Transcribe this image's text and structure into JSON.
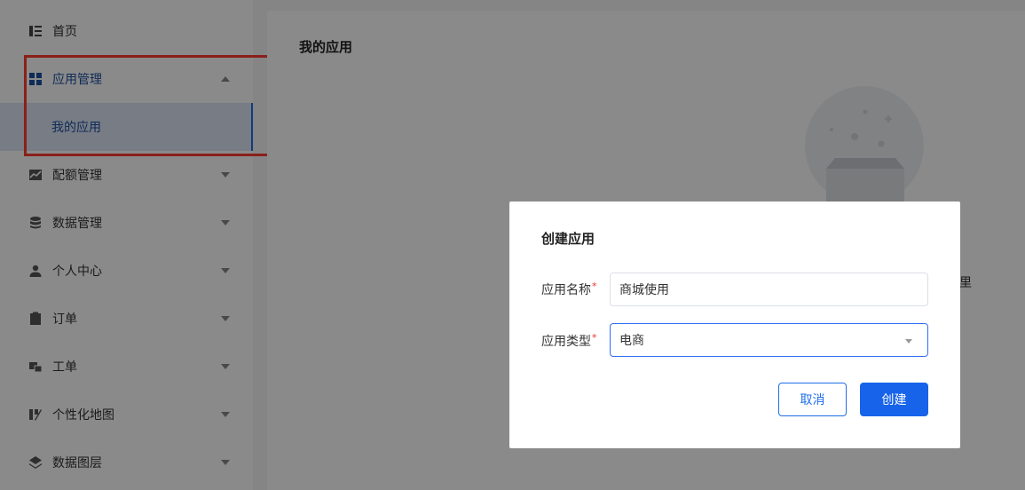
{
  "sidebar": {
    "items": [
      {
        "label": "首页",
        "icon": "home-list-icon"
      },
      {
        "label": "应用管理",
        "icon": "apps-grid-icon",
        "expanded": true
      },
      {
        "label": "配额管理",
        "icon": "quota-chart-icon"
      },
      {
        "label": "数据管理",
        "icon": "database-icon"
      },
      {
        "label": "个人中心",
        "icon": "user-icon"
      },
      {
        "label": "订单",
        "icon": "clipboard-icon"
      },
      {
        "label": "工单",
        "icon": "ticket-icon"
      },
      {
        "label": "个性化地图",
        "icon": "map-edit-icon"
      },
      {
        "label": "数据图层",
        "icon": "layers-icon"
      }
    ],
    "sub_item": {
      "label": "我的应用"
    }
  },
  "main": {
    "title": "我的应用",
    "peek_text": "里"
  },
  "dialog": {
    "title": "创建应用",
    "name_label": "应用名称",
    "name_value": "商城使用",
    "type_label": "应用类型",
    "type_value": "电商",
    "required_mark": "*",
    "cancel_label": "取消",
    "create_label": "创建"
  },
  "colors": {
    "accent": "#1763ea",
    "active_text": "#1e50a2",
    "active_bg": "#dce6f5",
    "highlight": "#ff3b30",
    "required": "#e33333"
  }
}
